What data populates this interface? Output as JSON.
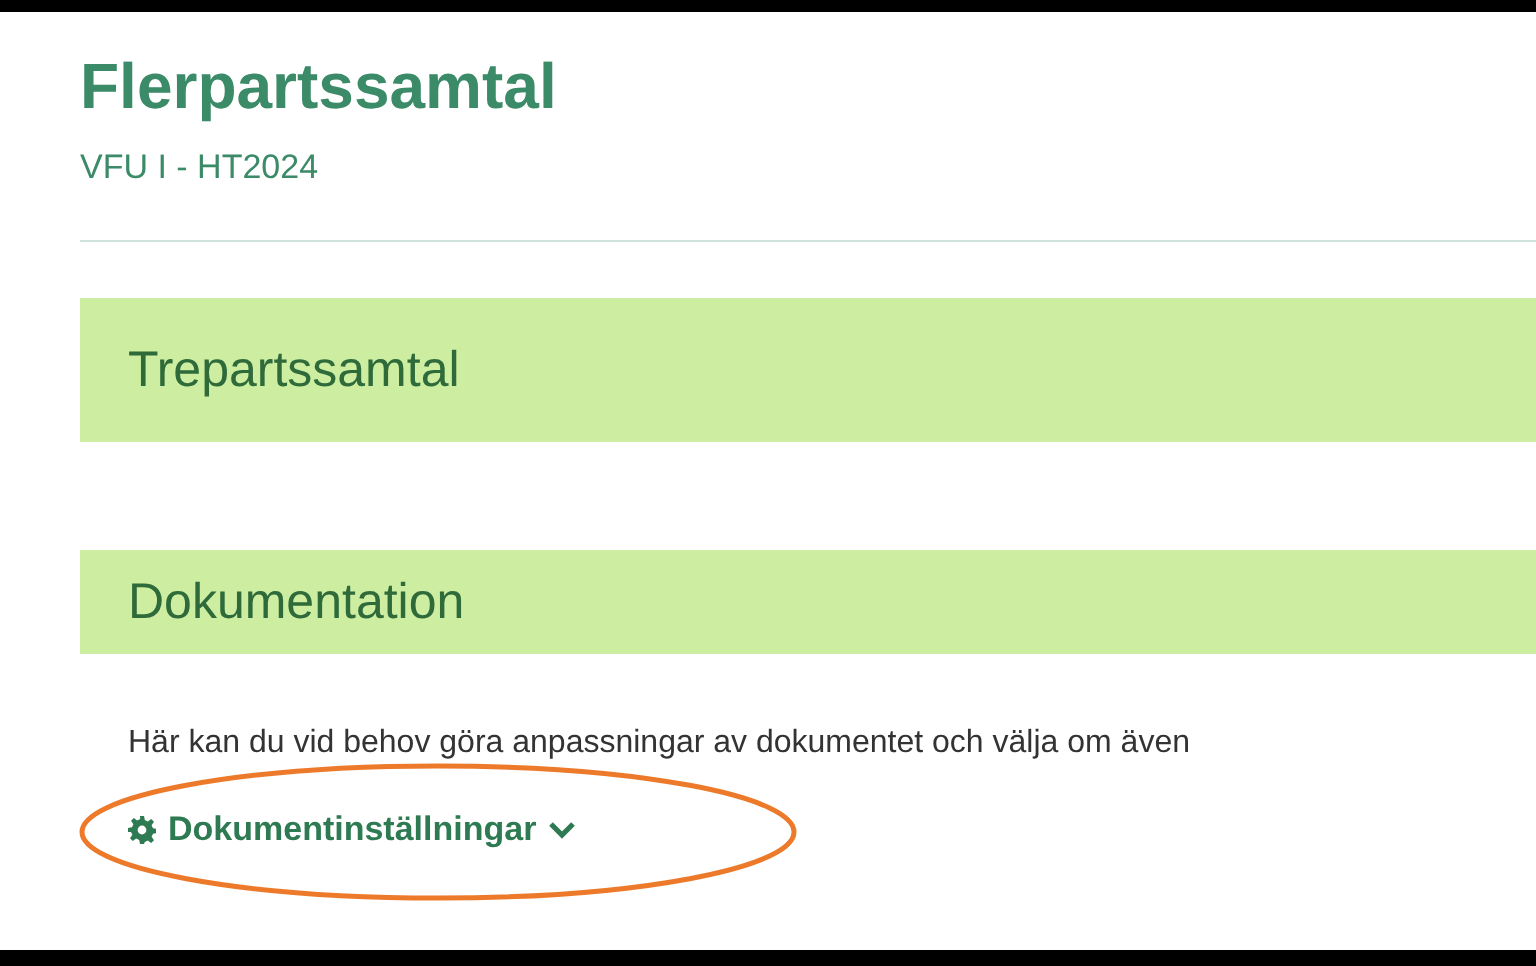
{
  "page": {
    "title": "Flerpartssamtal",
    "subtitle": "VFU I - HT2024"
  },
  "sections": [
    {
      "heading": "Trepartssamtal"
    },
    {
      "heading": "Dokumentation",
      "description": "Här kan du vid behov göra anpassningar av dokumentet och välja om även",
      "link": {
        "label": "Dokumentinställningar",
        "expanded": false,
        "highlighted": true
      }
    }
  ]
}
